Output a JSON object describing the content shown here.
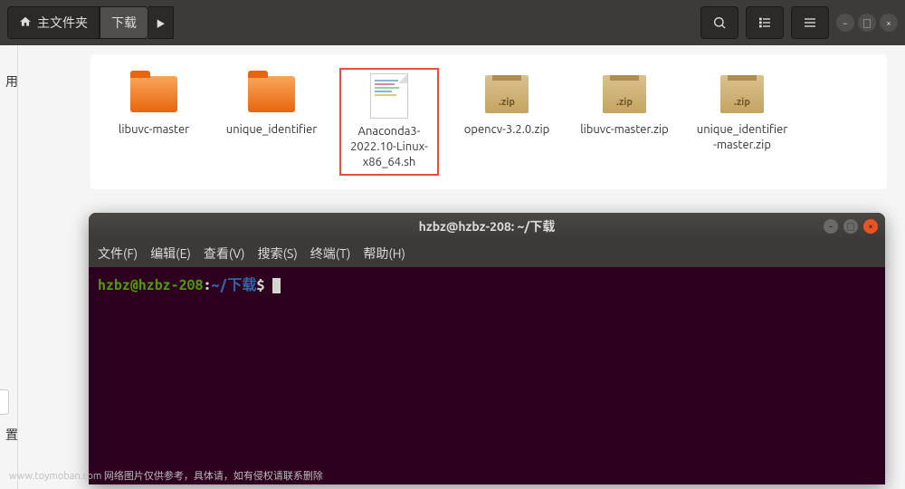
{
  "toolbar": {
    "home_label": "主文件夹",
    "current_folder": "下载"
  },
  "files": [
    {
      "name": "libuvc-master",
      "type": "folder"
    },
    {
      "name": "unique_identifier",
      "type": "folder"
    },
    {
      "name": "Anaconda3-2022.10-Linux-x86_64.sh",
      "type": "text",
      "highlighted": true
    },
    {
      "name": "opencv-3.2.0.zip",
      "type": "zip"
    },
    {
      "name": "libuvc-master.zip",
      "type": "zip"
    },
    {
      "name": "unique_identifier-master.zip",
      "type": "zip"
    }
  ],
  "zip_label": ".zip",
  "sidebar": {
    "frag1": "用",
    "frag2": "置"
  },
  "terminal": {
    "title": "hzbz@hzbz-208: ~/下载",
    "menu": {
      "file": "文件(F)",
      "edit": "编辑(E)",
      "view": "查看(V)",
      "search": "搜索(S)",
      "terminal": "终端(T)",
      "help": "帮助(H)"
    },
    "prompt": {
      "user_host": "hzbz@hzbz-208",
      "colon": ":",
      "path": "~/下载",
      "symbol": "$"
    }
  },
  "watermark": "www.toymoban.com 网络图片仅供参考，具体请，如有侵权请联系删除"
}
